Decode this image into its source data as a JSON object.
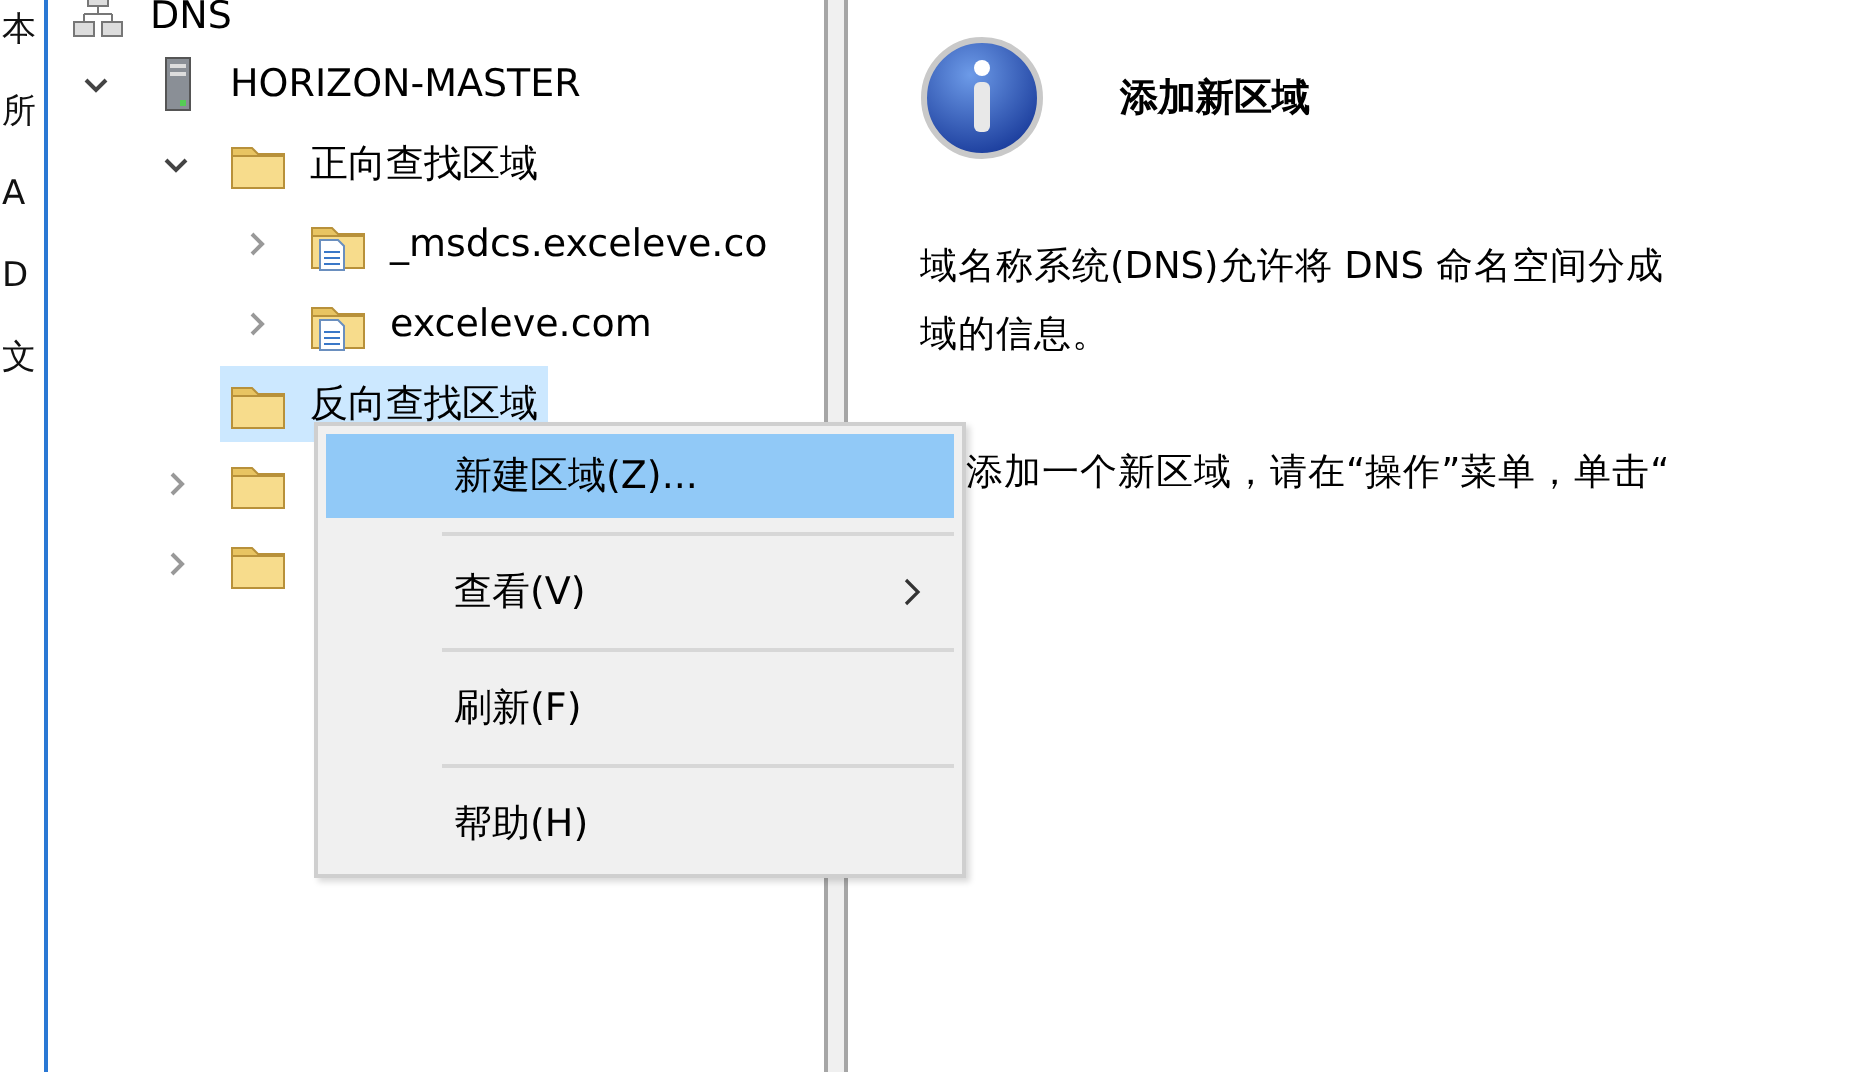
{
  "left_strip": {
    "texts": [
      "本",
      "所",
      "A",
      "D",
      "文"
    ]
  },
  "tree": [
    {
      "label": "DNS",
      "kind": "dns",
      "selected": false,
      "children": [
        {
          "label": "HORIZON-MASTER",
          "kind": "server",
          "expanded": true,
          "selected": false,
          "children": [
            {
              "label": "正向查找区域",
              "kind": "folder",
              "expanded": true,
              "selected": false,
              "children": [
                {
                  "label": "_msdcs.exceleve.co",
                  "kind": "zone",
                  "expanded": false,
                  "selected": false
                },
                {
                  "label": "exceleve.com",
                  "kind": "zone",
                  "expanded": false,
                  "selected": false
                }
              ]
            },
            {
              "label": "反向查找区域",
              "kind": "folder",
              "selected": true
            },
            {
              "kind": "folder",
              "expanded": false,
              "selected": false
            },
            {
              "kind": "folder",
              "expanded": false,
              "selected": false
            }
          ]
        }
      ]
    }
  ],
  "detail": {
    "title": "添加新区域",
    "paragraphs": [
      "域名称系统(DNS)允许将 DNS 命名空间分成",
      "域的信息。",
      "添加一个新区域，请在“操作”菜单，单击“"
    ]
  },
  "context_menu": [
    {
      "label": "新建区域(Z)...",
      "selected": true,
      "submenu": false
    },
    {
      "label": "查看(V)",
      "selected": false,
      "submenu": true
    },
    {
      "label": "刷新(F)",
      "selected": false,
      "submenu": false
    },
    {
      "label": "帮助(H)",
      "selected": false,
      "submenu": false
    }
  ]
}
